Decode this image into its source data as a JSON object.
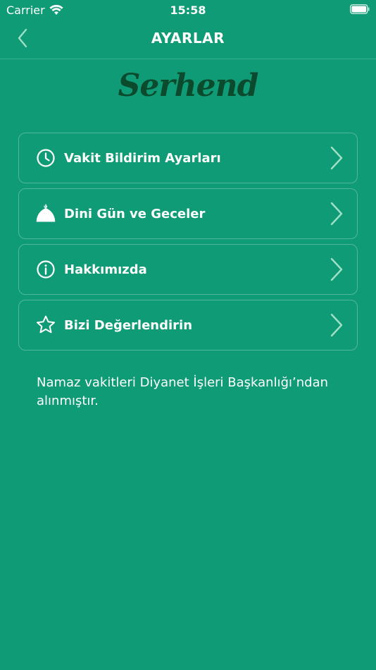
{
  "status_bar": {
    "carrier": "Carrier",
    "time": "15:58"
  },
  "nav": {
    "title": "AYARLAR",
    "back_icon": "chevron-left-icon"
  },
  "logo": {
    "text": "Serhend"
  },
  "menu": {
    "items": [
      {
        "label": "Vakit Bildirim Ayarları",
        "icon": "clock-icon"
      },
      {
        "label": "Dini Gün ve Geceler",
        "icon": "mosque-dome-icon"
      },
      {
        "label": "Hakkımızda",
        "icon": "info-icon"
      },
      {
        "label": "Bizi Değerlendirin",
        "icon": "star-icon"
      }
    ]
  },
  "footnote": "Namaz vakitleri Diyanet İşleri Başkanlığı’ndan alınmıştır.",
  "colors": {
    "background": "#0f9b76",
    "logo": "#0c4a2e",
    "chevron": "#9fe0c6"
  }
}
